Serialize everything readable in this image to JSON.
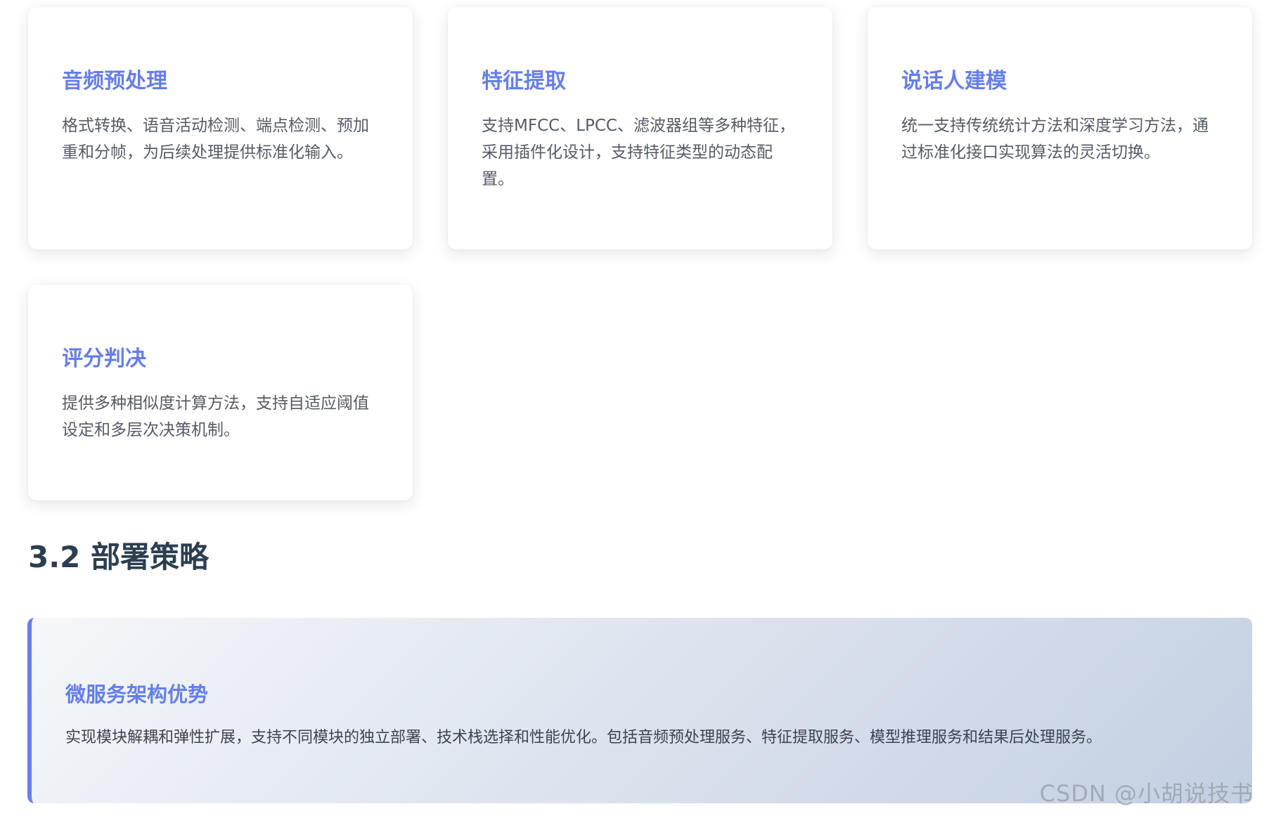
{
  "cards": [
    {
      "title": "音频预处理",
      "description": "格式转换、语音活动检测、端点检测、预加重和分帧，为后续处理提供标准化输入。"
    },
    {
      "title": "特征提取",
      "description": "支持MFCC、LPCC、滤波器组等多种特征，采用插件化设计，支持特征类型的动态配置。"
    },
    {
      "title": "说话人建模",
      "description": "统一支持传统统计方法和深度学习方法，通过标准化接口实现算法的灵活切换。"
    },
    {
      "title": "评分判决",
      "description": "提供多种相似度计算方法，支持自适应阈值设定和多层次决策机制。"
    }
  ],
  "section": {
    "heading": "3.2 部署策略"
  },
  "highlight": {
    "title": "微服务架构优势",
    "description": "实现模块解耦和弹性扩展，支持不同模块的独立部署、技术栈选择和性能优化。包括音频预处理服务、特征提取服务、模型推理服务和结果后处理服务。"
  },
  "watermark": "CSDN @小胡说技书",
  "colors": {
    "accent": "#667eea",
    "heading": "#2c3e50",
    "body_text": "#555b66"
  }
}
